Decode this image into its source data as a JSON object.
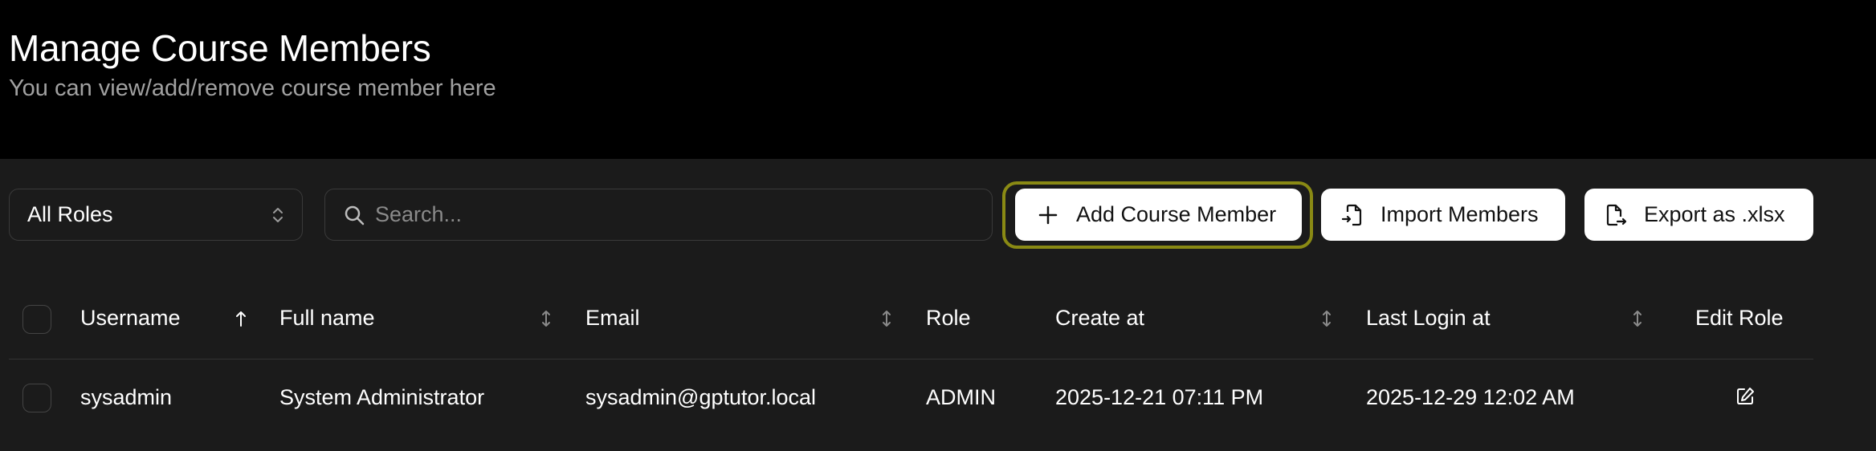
{
  "header": {
    "title": "Manage Course Members",
    "subtitle": "You can view/add/remove course member here"
  },
  "toolbar": {
    "role_filter": {
      "selected": "All Roles",
      "icon": "chevron-up-down-icon"
    },
    "search": {
      "placeholder": "Search...",
      "value": "",
      "icon": "search-icon"
    },
    "buttons": {
      "add_label": "Add Course Member",
      "import_label": "Import Members",
      "export_label": "Export as .xlsx"
    },
    "focus_ring_color": "#8a8a14"
  },
  "table": {
    "columns": [
      {
        "label": "Username",
        "sort": "ascending"
      },
      {
        "label": "Full name",
        "sort": "none"
      },
      {
        "label": "Email",
        "sort": "none"
      },
      {
        "label": "Role",
        "sort": ""
      },
      {
        "label": "Create at",
        "sort": "none"
      },
      {
        "label": "Last Login at",
        "sort": "none"
      },
      {
        "label": "Edit Role",
        "sort": ""
      }
    ],
    "rows": [
      {
        "username": "sysadmin",
        "full_name": "System Administrator",
        "email": "sysadmin@gptutor.local",
        "role": "ADMIN",
        "created_at": "2025-12-21 07:11 PM",
        "last_login_at": "2025-12-29 12:02 AM",
        "edit_icon": "edit-icon"
      }
    ]
  },
  "colors": {
    "header_bg": "#000000",
    "content_bg": "#1b1b1b",
    "button_bg": "#ffffff",
    "subtitle_text": "#a1a1a1",
    "placeholder_text": "#8a8a8a"
  }
}
